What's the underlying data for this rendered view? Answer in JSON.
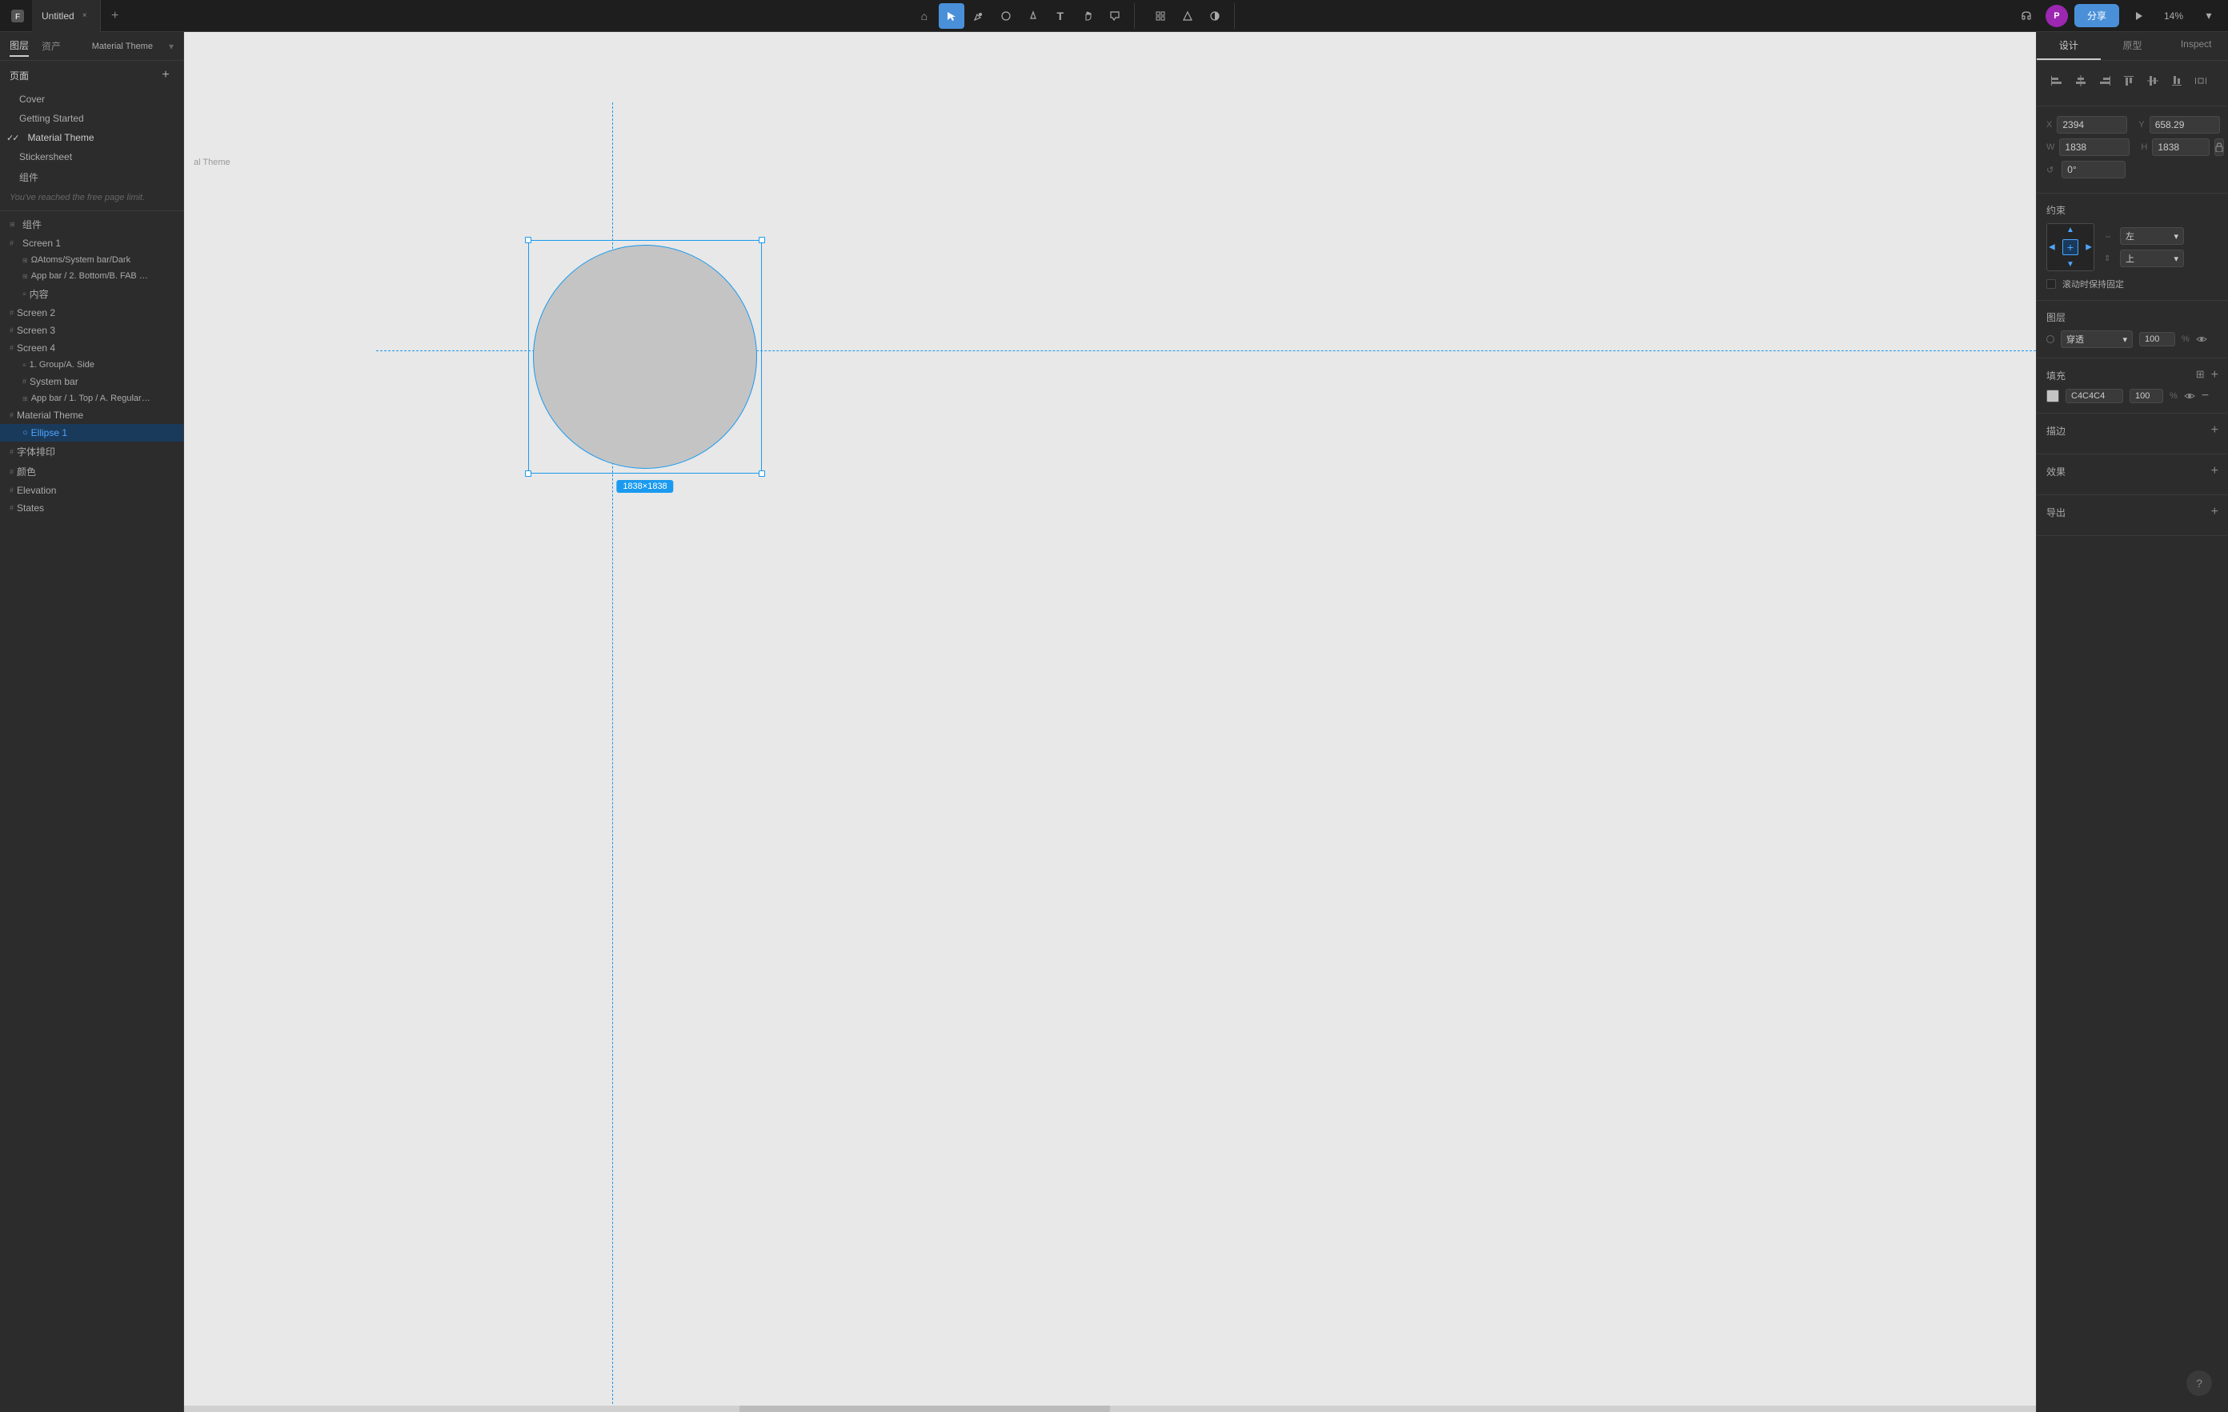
{
  "app": {
    "title": "Untitled",
    "zoom": "14%"
  },
  "topbar": {
    "tabs": [
      {
        "label": "Untitled",
        "active": true
      }
    ],
    "tools": {
      "select": "▲",
      "pen": "✏",
      "shape": "○",
      "vector": "⬡",
      "text": "T",
      "hand": "✋",
      "comment": "💬"
    },
    "center_tools": {
      "components": "⊞",
      "assets": "◆",
      "contrast": "◑"
    },
    "share_label": "分享",
    "avatar_initials": "P",
    "zoom_level": "14%",
    "play_btn": "▶"
  },
  "sidebar": {
    "tabs": [
      "图层",
      "资产"
    ],
    "breadcrumb": "Material Theme",
    "pages_title": "页面",
    "pages": [
      {
        "label": "Cover",
        "active": false
      },
      {
        "label": "Getting Started",
        "active": false
      },
      {
        "label": "Material Theme",
        "active": true
      },
      {
        "label": "Stickersheet",
        "active": false
      },
      {
        "label": "组件",
        "active": false
      }
    ],
    "free_limit": "You've reached the free page limit.",
    "layers": [
      {
        "label": "组件",
        "icon": "#",
        "indent": 0,
        "active": false
      },
      {
        "label": "Screen 1",
        "icon": "#",
        "indent": 0,
        "active": false
      },
      {
        "label": "ΩAtoms/System bar/Dark",
        "icon": "⊞",
        "indent": 1,
        "active": false
      },
      {
        "label": "App bar / 2. Bottom/B. FAB ce...",
        "icon": "⊞",
        "indent": 1,
        "active": false
      },
      {
        "label": "内容",
        "icon": "≡",
        "indent": 1,
        "active": false
      },
      {
        "label": "Screen 2",
        "icon": "#",
        "indent": 0,
        "active": false
      },
      {
        "label": "Screen 3",
        "icon": "#",
        "indent": 0,
        "active": false
      },
      {
        "label": "Screen 4",
        "icon": "#",
        "indent": 0,
        "active": false
      },
      {
        "label": "1. Group/A. Side",
        "icon": "≡",
        "indent": 1,
        "active": false
      },
      {
        "label": "System bar",
        "icon": "#",
        "indent": 1,
        "active": false
      },
      {
        "label": "App bar / 1. Top / A. Regular/ ...",
        "icon": "⊞",
        "indent": 1,
        "active": false
      },
      {
        "label": "Material Theme",
        "icon": "#",
        "indent": 0,
        "active": false
      },
      {
        "label": "Ellipse 1",
        "icon": "○",
        "indent": 1,
        "active": true
      },
      {
        "label": "字体排印",
        "icon": "#",
        "indent": 0,
        "active": false
      },
      {
        "label": "颜色",
        "icon": "#",
        "indent": 0,
        "active": false
      },
      {
        "label": "Elevation",
        "icon": "#",
        "indent": 0,
        "active": false
      },
      {
        "label": "States",
        "icon": "#",
        "indent": 0,
        "active": false
      }
    ]
  },
  "canvas": {
    "label": "al Theme",
    "element_size": "1838×1838"
  },
  "right_panel": {
    "tabs": [
      "设计",
      "原型",
      "Inspect"
    ],
    "active_tab": "设计",
    "alignment": {
      "title": "",
      "buttons": [
        "align-left",
        "align-center-h",
        "align-right",
        "align-top",
        "align-center-v",
        "align-bottom",
        "distribute-h"
      ]
    },
    "position": {
      "x_label": "X",
      "x_value": "2394",
      "y_label": "Y",
      "y_value": "658.29",
      "w_label": "W",
      "w_value": "1838",
      "h_label": "H",
      "h_value": "1838",
      "rotation_label": "0°"
    },
    "constraints": {
      "title": "约束",
      "h_label": "左",
      "v_label": "上",
      "scroll_fixed_label": "滚动时保持固定"
    },
    "layer": {
      "title": "图层",
      "blend_mode": "穿透",
      "opacity": "100%",
      "opacity_value": "100"
    },
    "fill": {
      "title": "填充",
      "color": "C4C4C4",
      "opacity": "100%"
    },
    "stroke": {
      "title": "描边"
    },
    "effects": {
      "title": "效果"
    },
    "export": {
      "title": "导出"
    }
  }
}
